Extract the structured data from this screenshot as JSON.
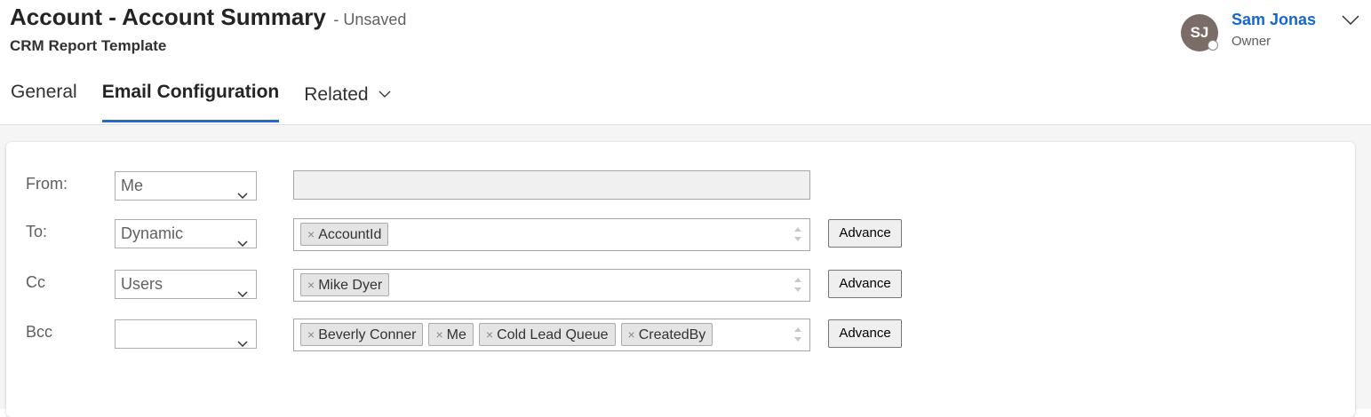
{
  "record": {
    "title": "Account - Account Summary",
    "save_state": "- Unsaved",
    "subtitle": "CRM Report Template"
  },
  "tabs": [
    {
      "label": "General",
      "active": false
    },
    {
      "label": "Email Configuration",
      "active": true
    },
    {
      "label": "Related",
      "active": false,
      "has_dropdown": true
    }
  ],
  "owner": {
    "initials": "SJ",
    "name": "Sam Jonas",
    "role": "Owner"
  },
  "email_config": {
    "from": {
      "label": "From:",
      "selected": "Me",
      "value": ""
    },
    "to": {
      "label": "To:",
      "selected": "Dynamic",
      "tags": [
        "AccountId"
      ],
      "button": "Advance"
    },
    "cc": {
      "label": "Cc",
      "selected": "Users",
      "tags": [
        "Mike Dyer"
      ],
      "button": "Advance"
    },
    "bcc": {
      "label": "Bcc",
      "selected": "",
      "tags": [
        "Beverly Conner",
        "Me",
        "Cold Lead Queue",
        "CreatedBy"
      ],
      "button": "Advance"
    }
  },
  "tag_remove_glyph": "×",
  "icons": {
    "chevron": "chevron-down-icon",
    "spinner": "spinner-arrows-icon",
    "presence": "presence-offline-icon"
  },
  "colors": {
    "accent": "#2266e3",
    "owner_link": "#1366d6",
    "avatar_bg": "#7a6c67",
    "page_bg": "#f5f5f5"
  }
}
